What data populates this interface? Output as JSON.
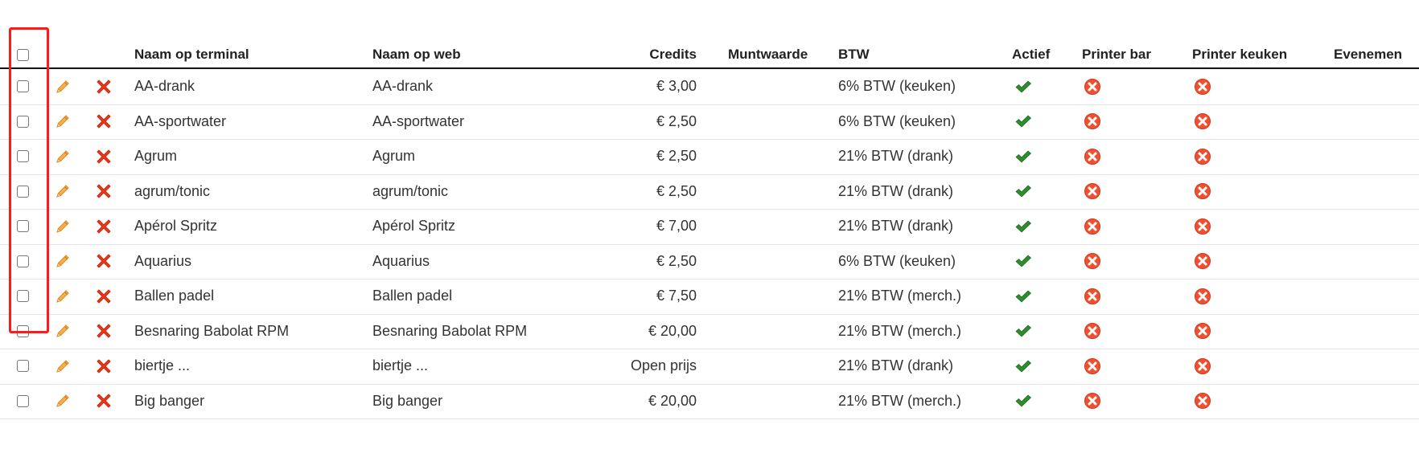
{
  "columns": {
    "terminal": "Naam op terminal",
    "web": "Naam op web",
    "credits": "Credits",
    "muntwaarde": "Muntwaarde",
    "btw": "BTW",
    "actief": "Actief",
    "printer_bar": "Printer bar",
    "printer_keuken": "Printer keuken",
    "evenementen": "Evenemen"
  },
  "rows": [
    {
      "terminal": "AA-drank",
      "web": "AA-drank",
      "credits": "€ 3,00",
      "muntwaarde": "",
      "btw": "6% BTW (keuken)",
      "actief": true,
      "printer_bar": false,
      "printer_keuken": false
    },
    {
      "terminal": "AA-sportwater",
      "web": "AA-sportwater",
      "credits": "€ 2,50",
      "muntwaarde": "",
      "btw": "6% BTW (keuken)",
      "actief": true,
      "printer_bar": false,
      "printer_keuken": false
    },
    {
      "terminal": "Agrum",
      "web": "Agrum",
      "credits": "€ 2,50",
      "muntwaarde": "",
      "btw": "21% BTW (drank)",
      "actief": true,
      "printer_bar": false,
      "printer_keuken": false
    },
    {
      "terminal": "agrum/tonic",
      "web": "agrum/tonic",
      "credits": "€ 2,50",
      "muntwaarde": "",
      "btw": "21% BTW (drank)",
      "actief": true,
      "printer_bar": false,
      "printer_keuken": false
    },
    {
      "terminal": "Apérol Spritz",
      "web": "Apérol Spritz",
      "credits": "€ 7,00",
      "muntwaarde": "",
      "btw": "21% BTW (drank)",
      "actief": true,
      "printer_bar": false,
      "printer_keuken": false
    },
    {
      "terminal": "Aquarius",
      "web": "Aquarius",
      "credits": "€ 2,50",
      "muntwaarde": "",
      "btw": "6% BTW (keuken)",
      "actief": true,
      "printer_bar": false,
      "printer_keuken": false
    },
    {
      "terminal": "Ballen padel",
      "web": "Ballen padel",
      "credits": "€ 7,50",
      "muntwaarde": "",
      "btw": "21% BTW (merch.)",
      "actief": true,
      "printer_bar": false,
      "printer_keuken": false
    },
    {
      "terminal": "Besnaring Babolat RPM",
      "web": "Besnaring Babolat RPM",
      "credits": "€ 20,00",
      "muntwaarde": "",
      "btw": "21% BTW (merch.)",
      "actief": true,
      "printer_bar": false,
      "printer_keuken": false
    },
    {
      "terminal": "biertje ...",
      "web": "biertje ...",
      "credits": "Open prijs",
      "muntwaarde": "",
      "btw": "21% BTW (drank)",
      "actief": true,
      "printer_bar": false,
      "printer_keuken": false
    },
    {
      "terminal": "Big banger",
      "web": "Big banger",
      "credits": "€ 20,00",
      "muntwaarde": "",
      "btw": "21% BTW (merch.)",
      "actief": true,
      "printer_bar": false,
      "printer_keuken": false
    }
  ],
  "icons": {
    "edit": "pencil-icon",
    "delete": "delete-x-icon",
    "active": "checkmark-icon",
    "inactive": "red-circle-x-icon"
  },
  "colors": {
    "pencil": "#f0a030",
    "delete": "#ee3a1a",
    "check": "#2e8b2e",
    "inactive": "#f05030",
    "highlight": "#ff1a1a"
  }
}
